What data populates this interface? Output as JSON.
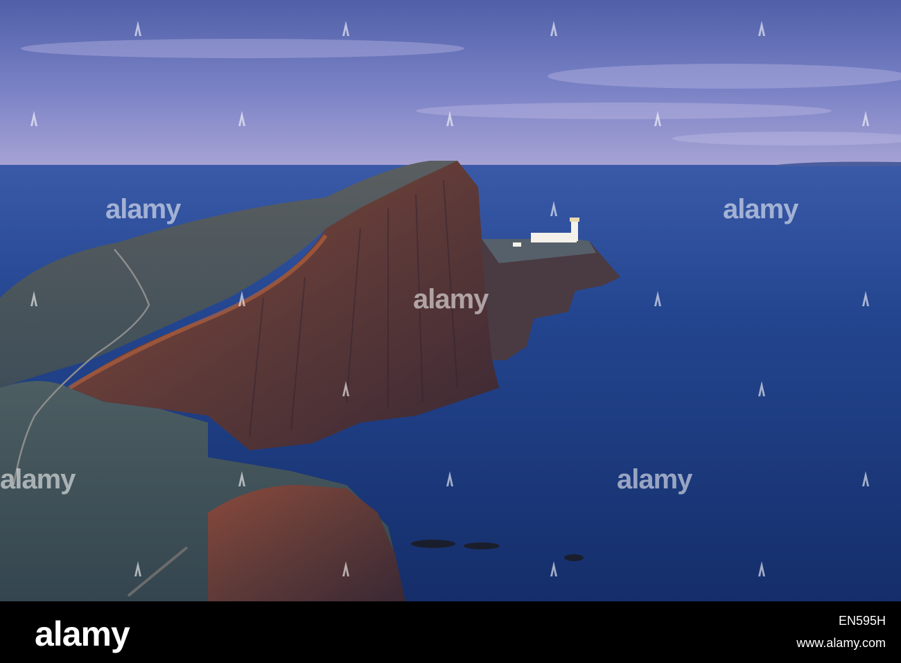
{
  "watermark": {
    "text": "alamy",
    "color": "#ffffff"
  },
  "footer": {
    "logo_text": "alamy",
    "image_id": "EN595H",
    "site_url": "www.alamy.com"
  },
  "scene": {
    "subject": "lighthouse-on-sea-cliff-headland",
    "colors": {
      "sky_top": "#5b6ab0",
      "sky_horizon": "#a9a6d6",
      "sea": "#1e3d84",
      "sea_dark": "#132a63",
      "cliff_rock": "#6a3f3a",
      "cliff_shadow": "#3a2a34",
      "grass": "#4d5a66",
      "lighthouse": "#f4f1ea"
    }
  }
}
